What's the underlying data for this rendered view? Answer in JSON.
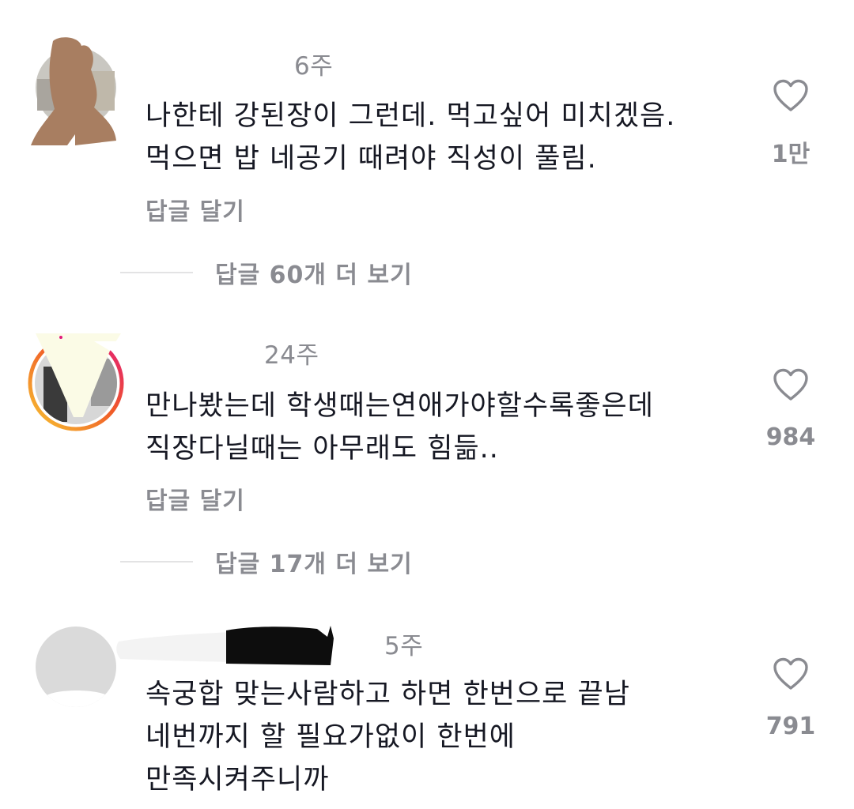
{
  "comments": [
    {
      "time": "6주",
      "lines": [
        "나한테 강된장이 그런데. 먹고싶어 미치겠음.",
        "먹으면 밥 네공기 때려야 직성이 풀림."
      ],
      "reply_label": "답글 달기",
      "likes": "1만",
      "view_replies": "답글 60개 더 보기"
    },
    {
      "time": "24주",
      "lines": [
        "만나봤는데 학생때는연애가야할수록좋은데",
        "직장다닐때는 아무래도 힘듦.."
      ],
      "reply_label": "답글 달기",
      "likes": "984",
      "view_replies": "답글 17개 더 보기"
    },
    {
      "time": "5주",
      "lines": [
        "속궁합 맞는사람하고 하면 한번으로 끝남",
        "네번까지 할 필요가없이  한번에",
        "만족시켜주니까"
      ],
      "likes": "791"
    }
  ],
  "colors": {
    "text": "#161823",
    "muted": "#8a8b91",
    "divider": "#e3e3e4",
    "story_ring_start": "#f7c531",
    "story_ring_end": "#e2197b"
  },
  "icons": {
    "like": "heart-outline-icon"
  }
}
